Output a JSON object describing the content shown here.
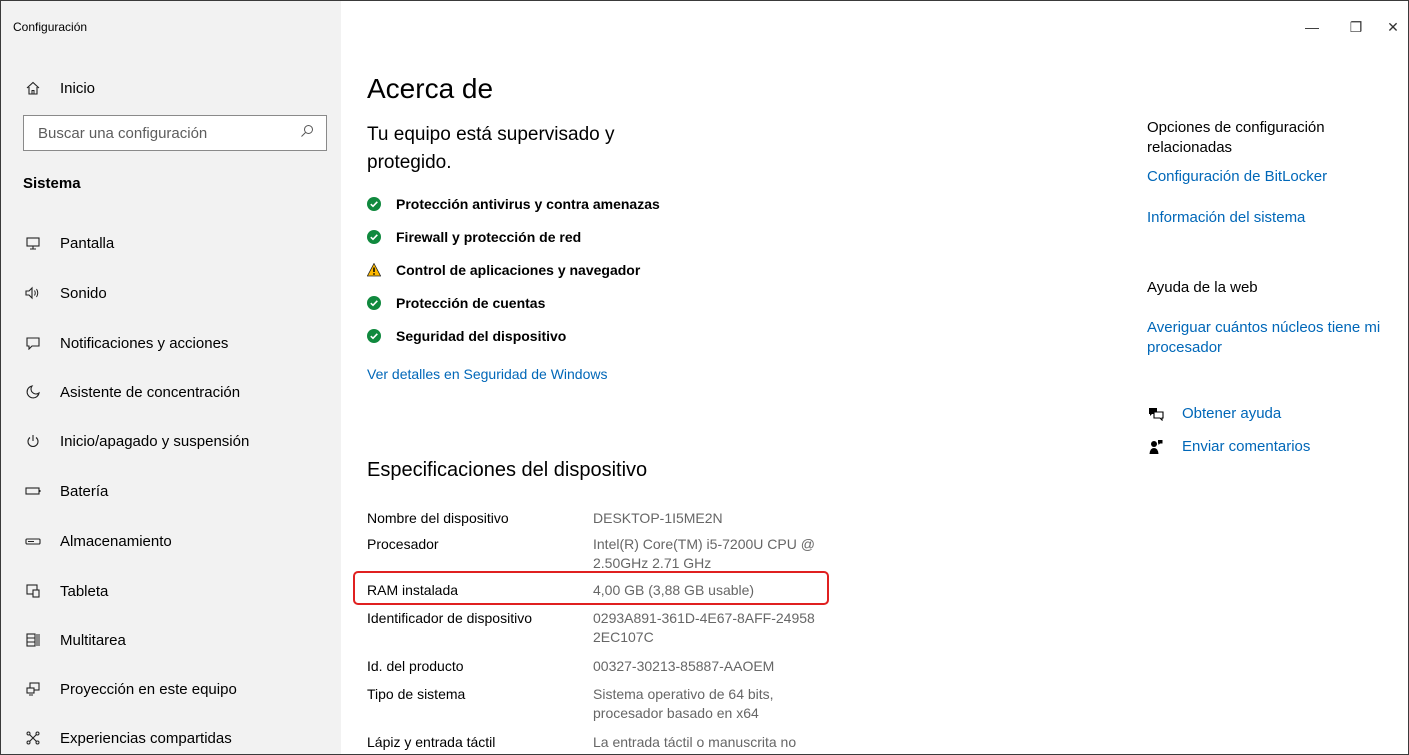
{
  "window": {
    "title": "Configuración",
    "minimize_glyph": "—",
    "restore_glyph": "❐",
    "close_glyph": "✕"
  },
  "sidebar": {
    "home_label": "Inicio",
    "home_icon": "home-icon",
    "search_placeholder": "Buscar una configuración",
    "section_title": "Sistema",
    "items": [
      {
        "label": "Pantalla",
        "icon": "monitor-icon"
      },
      {
        "label": "Sonido",
        "icon": "speaker-icon"
      },
      {
        "label": "Notificaciones y acciones",
        "icon": "notification-icon"
      },
      {
        "label": "Asistente de concentración",
        "icon": "moon-icon"
      },
      {
        "label": "Inicio/apagado y suspensión",
        "icon": "power-icon"
      },
      {
        "label": "Batería",
        "icon": "battery-icon"
      },
      {
        "label": "Almacenamiento",
        "icon": "storage-icon"
      },
      {
        "label": "Tableta",
        "icon": "tablet-icon"
      },
      {
        "label": "Multitarea",
        "icon": "multitask-icon"
      },
      {
        "label": "Proyección en este equipo",
        "icon": "projection-icon"
      },
      {
        "label": "Experiencias compartidas",
        "icon": "shared-icon"
      }
    ]
  },
  "main": {
    "title": "Acerca de",
    "status_title": "Tu equipo está supervisado y protegido.",
    "protections": [
      {
        "label": "Protección antivirus y contra amenazas",
        "status": "ok"
      },
      {
        "label": "Firewall y protección de red",
        "status": "ok"
      },
      {
        "label": "Control de aplicaciones y navegador",
        "status": "warning"
      },
      {
        "label": "Protección de cuentas",
        "status": "ok"
      },
      {
        "label": "Seguridad del dispositivo",
        "status": "ok"
      }
    ],
    "details_link": "Ver detalles en Seguridad de Windows",
    "specs_title": "Especificaciones del dispositivo",
    "specs": [
      {
        "label": "Nombre del dispositivo",
        "value": "DESKTOP-1I5ME2N"
      },
      {
        "label": "Procesador",
        "value": "Intel(R) Core(TM) i5-7200U CPU @ 2.50GHz   2.71 GHz"
      },
      {
        "label": "RAM instalada",
        "value": "4,00 GB (3,88 GB usable)"
      },
      {
        "label": "Identificador de dispositivo",
        "value": "0293A891-361D-4E67-8AFF-24958 2EC107C"
      },
      {
        "label": "Id. del producto",
        "value": "00327-30213-85887-AAOEM"
      },
      {
        "label": "Tipo de sistema",
        "value": "Sistema operativo de 64 bits, procesador basado en x64"
      },
      {
        "label": "Lápiz y entrada táctil",
        "value": "La entrada táctil o manuscrita no"
      }
    ]
  },
  "right": {
    "related_title": "Opciones de configuración relacionadas",
    "bitlocker_link": "Configuración de BitLocker",
    "sysinfo_link": "Información del sistema",
    "web_help_title": "Ayuda de la web",
    "cores_link": "Averiguar cuántos núcleos tiene mi procesador",
    "get_help": "Obtener ayuda",
    "feedback": "Enviar comentarios"
  },
  "colors": {
    "accent": "#0067b8",
    "ok": "#10893e",
    "warning": "#ffb900",
    "highlight": "#e02020",
    "sidebar_bg": "#f2f2f2"
  }
}
